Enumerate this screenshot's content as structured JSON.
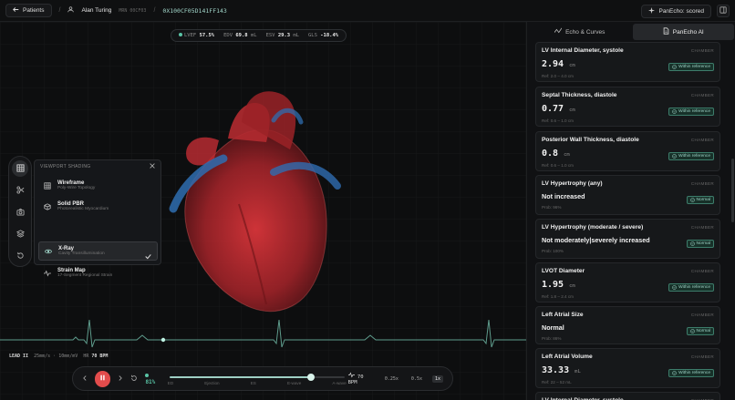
{
  "topbar": {
    "back_label": "Patients",
    "separator": "/",
    "patient_name": "Alan Turing",
    "patient_mrn": "MRN 00CF03",
    "separator2": "/",
    "study_hash": "0X100CF05D141FF143",
    "status_label": "PanEcho: scored"
  },
  "metrics": {
    "lvef_label": "LVEF",
    "lvef_value": "57.5%",
    "edv_label": "EDV",
    "edv_value": "69.8",
    "edv_unit": "mL",
    "esv_label": "ESV",
    "esv_value": "29.3",
    "esv_unit": "mL",
    "gls_label": "GLS",
    "gls_value": "-18.4%"
  },
  "shading": {
    "header": "VIEWPORT SHADING",
    "options": [
      {
        "title": "Wireframe",
        "subtitle": "Poly-Wire Topology",
        "icon": "grid-icon"
      },
      {
        "title": "Solid PBR",
        "subtitle": "Photorealistic Myocardium",
        "icon": "cube-icon"
      },
      {
        "title": "X-Ray",
        "subtitle": "Cavity Transillumination",
        "icon": "eye-icon",
        "selected": true
      },
      {
        "title": "Strain Map",
        "subtitle": "17-Segment Regional Strain",
        "icon": "pulse-icon"
      }
    ]
  },
  "ecg": {
    "lead": "LEAD II",
    "speed": "25mm/s · 10mm/mV",
    "hr_label": "HR",
    "hr_value": "70 BPM"
  },
  "player": {
    "progress_pct": "81%",
    "progress_fraction": 0.81,
    "phases": [
      "ED",
      "Ejection",
      "ES",
      "E-wave",
      "A-wave"
    ],
    "bpm": "70 BPM",
    "speeds": [
      "0.25x",
      "0.5x",
      "1x"
    ],
    "active_speed": "1x"
  },
  "panel": {
    "tabs": [
      {
        "label": "Echo & Curves",
        "icon": "curve-icon"
      },
      {
        "label": "PanEcho AI",
        "icon": "document-icon",
        "active": true
      }
    ],
    "cards": [
      {
        "title": "LV Internal Diameter, systole",
        "category": "CHAMBER",
        "value": "2.94",
        "unit": "cm",
        "badge": "Within reference",
        "note": "Ref: 2.0 – 4.0 cm"
      },
      {
        "title": "Septal Thickness, diastole",
        "category": "CHAMBER",
        "value": "0.77",
        "unit": "cm",
        "badge": "Within reference",
        "note": "Ref: 0.6 – 1.0 cm"
      },
      {
        "title": "Posterior Wall Thickness, diastole",
        "category": "CHAMBER",
        "value": "0.8",
        "unit": "cm",
        "badge": "Within reference",
        "note": "Ref: 0.6 – 1.0 cm"
      },
      {
        "title": "LV Hypertrophy (any)",
        "category": "CHAMBER",
        "value": "Not increased",
        "unit": "",
        "badge": "Normal",
        "note": "Prob: 96%"
      },
      {
        "title": "LV Hypertrophy (moderate / severe)",
        "category": "CHAMBER",
        "value": "Not moderately|severely increased",
        "unit": "",
        "badge": "Normal",
        "note": "Prob: 100%"
      },
      {
        "title": "LVOT Diameter",
        "category": "CHAMBER",
        "value": "1.95",
        "unit": "cm",
        "badge": "Within reference",
        "note": "Ref: 1.8 – 2.4 cm"
      },
      {
        "title": "Left Atrial Size",
        "category": "CHAMBER",
        "value": "Normal",
        "unit": "",
        "badge": "Normal",
        "note": "Prob: 86%"
      },
      {
        "title": "Left Atrial Volume",
        "category": "CHAMBER",
        "value": "33.33",
        "unit": "mL",
        "badge": "Within reference",
        "note": "Ref: 22 – 52 mL"
      },
      {
        "title": "LV Internal Diameter, systole",
        "category": "CHAMBER",
        "value": "",
        "unit": "",
        "badge": "",
        "note": ""
      }
    ]
  },
  "colors": {
    "accent": "#59c4a6",
    "record": "#e24c4c",
    "heart": "#c0282d",
    "vessel": "#2f6db0"
  }
}
